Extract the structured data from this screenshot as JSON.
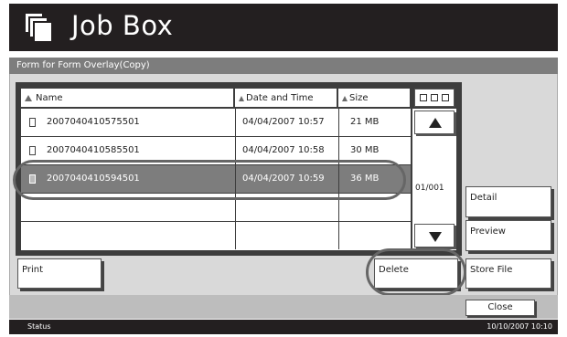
{
  "header": {
    "title": "Job Box",
    "icon": "job-box-icon"
  },
  "subtitle": "Form for Form Overlay(Copy)",
  "columns": {
    "name": "Name",
    "date": "Date and Time",
    "size": "Size"
  },
  "files": [
    {
      "name": "2007040410575501",
      "date": "04/04/2007 10:57",
      "size": "21 MB",
      "selected": false
    },
    {
      "name": "2007040410585501",
      "date": "04/04/2007 10:58",
      "size": "30 MB",
      "selected": false
    },
    {
      "name": "2007040410594501",
      "date": "04/04/2007 10:59",
      "size": "36 MB",
      "selected": true
    }
  ],
  "pager": {
    "indicator": "01/001"
  },
  "buttons": {
    "detail": "Detail",
    "preview": "Preview",
    "print": "Print",
    "delete": "Delete",
    "store_file": "Store File",
    "close": "Close"
  },
  "status": {
    "label": "Status",
    "datetime": "10/10/2007  10:10"
  },
  "colors": {
    "header_bg": "#231f20",
    "selected_row": "#7d7d7d",
    "panel_bg": "#d9d9d9"
  }
}
